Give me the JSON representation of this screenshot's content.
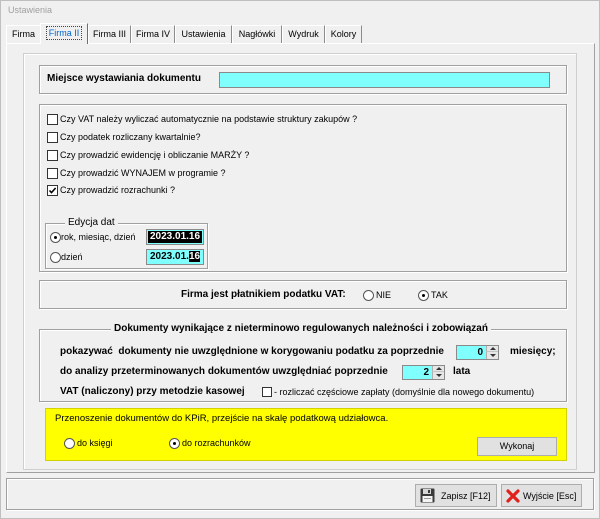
{
  "window": {
    "title": "Ustawienia"
  },
  "tabs": [
    {
      "label": "Firma",
      "selected": false
    },
    {
      "label": "Firma II",
      "selected": true
    },
    {
      "label": "Firma III",
      "selected": false
    },
    {
      "label": "Firma IV",
      "selected": false
    },
    {
      "label": "Ustawienia",
      "selected": false
    },
    {
      "label": "Nagłówki",
      "selected": false
    },
    {
      "label": "Wydruk",
      "selected": false
    },
    {
      "label": "Kolory",
      "selected": false
    }
  ],
  "place": {
    "label": "Miejsce wystawiania dokumentu"
  },
  "options": [
    {
      "label": "Czy VAT należy wyliczać automatycznie na podstawie struktury zakupów ?",
      "checked": false
    },
    {
      "label": "Czy podatek rozliczany kwartalnie?",
      "checked": false
    },
    {
      "label": "Czy prowadzić ewidencję i obliczanie MARŻY ?",
      "checked": false
    },
    {
      "label": "Czy prowadzić WYNAJEM w programie ?",
      "checked": false
    },
    {
      "label": "Czy prowadzić rozrachunki ?",
      "checked": true
    }
  ],
  "date_edit": {
    "legend": "Edycja dat",
    "modes": [
      {
        "label": "rok, miesiąc, dzień",
        "selected": true,
        "selected_text": "2023.01.16"
      },
      {
        "label": "dzień",
        "selected": false,
        "text": "2023.01.",
        "selected_text": "16"
      }
    ]
  },
  "vat_payer": {
    "label": "Firma jest płatnikiem podatku VAT:",
    "options": [
      {
        "label": "NIE",
        "selected": false
      },
      {
        "label": "TAK",
        "selected": true
      }
    ]
  },
  "overdue": {
    "legend": "Dokumenty wynikające z nieterminowo regulowanych należności i zobowiązań",
    "months": {
      "label": "pokazywać  dokumenty nie uwzględnione w korygowaniu podatku za poprzednie",
      "value": "0",
      "unit": "miesięcy;"
    },
    "years": {
      "label": "do analizy przeterminowanych dokumentów uwzględniać poprzednie",
      "value": "2",
      "unit": "lata"
    },
    "cash_vat": {
      "label": "VAT (naliczony) przy metodzie kasowej",
      "option_label": "- rozliczać częściowe zapłaty (domyślnie dla nowego dokumentu)",
      "checked": false
    }
  },
  "transfer": {
    "text": "Przenoszenie dokumentów do KPiR, przejście na skalę podatkową udziałowca.",
    "options": [
      {
        "label": "do księgi",
        "selected": false
      },
      {
        "label": "do rozrachunków",
        "selected": true
      }
    ],
    "button": "Wykonaj"
  },
  "footer": {
    "save": "Zapisz [F12]",
    "exit": "Wyjście [Esc]"
  },
  "icons": {
    "save": "floppy-disk-icon",
    "exit": "red-x-icon",
    "spinner": "spinner-arrows-icon"
  },
  "colors": {
    "field": "#80ffff",
    "notice": "#ffff00",
    "active_tab_text": "#0066cc",
    "exit_icon": "#e0201c"
  }
}
